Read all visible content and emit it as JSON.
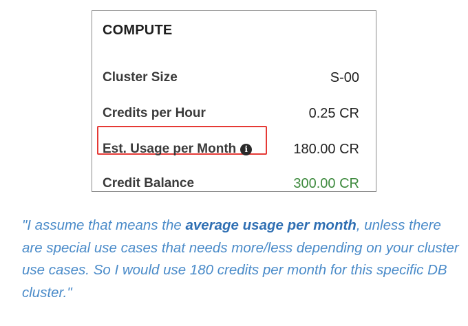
{
  "compute": {
    "title": "COMPUTE",
    "rows": [
      {
        "label": "Cluster Size",
        "value": "S-00"
      },
      {
        "label": "Credits per Hour",
        "value": "0.25 CR"
      },
      {
        "label": "Est. Usage per Month",
        "value": "180.00 CR",
        "icon": "info-icon"
      },
      {
        "label": "Credit Balance",
        "value": "300.00 CR"
      }
    ]
  },
  "colors": {
    "highlight_border": "#e53935",
    "balance_value": "#3e8a3e",
    "quote_text": "#4a8bc9"
  },
  "quote": {
    "before": "\"I assume that means the ",
    "emphasis": "average usage per month",
    "after": ", unless there are special use cases that needs more/less depending on your cluster use cases. So I would use 180 credits per month for this specific DB cluster.\""
  }
}
